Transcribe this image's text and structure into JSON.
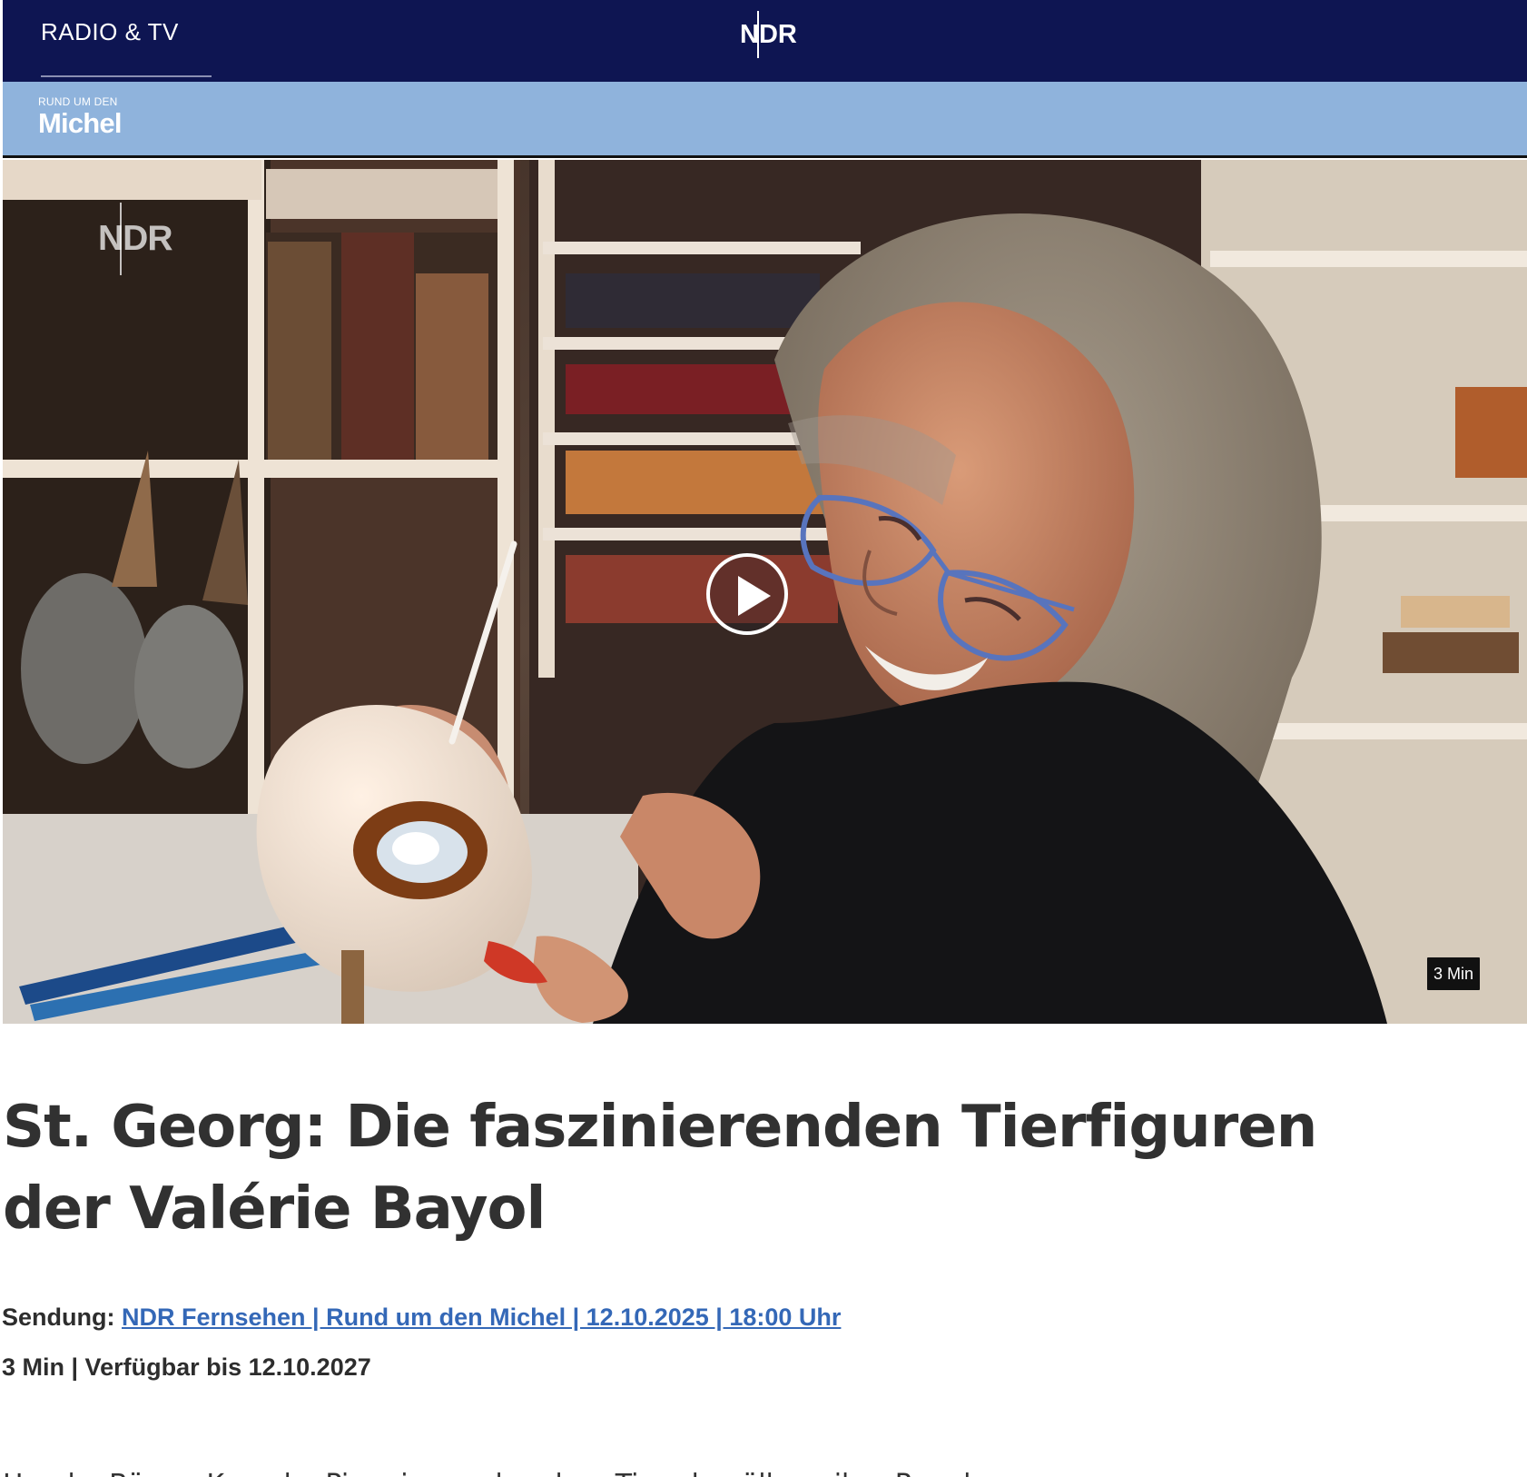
{
  "header": {
    "section_label": "RADIO & TV",
    "logo_text": "NDR"
  },
  "show": {
    "logo_small": "RUND UM DEN",
    "logo_big": "Michel"
  },
  "video": {
    "watermark": "NDR",
    "duration_badge": "3 Min"
  },
  "article": {
    "title": "St. Georg: Die faszinierenden Tierfiguren der Valérie Bayol",
    "broadcast_label": "Sendung:",
    "broadcast_link": "NDR Fernsehen | Rund um den Michel | 12.10.2025 | 18:00 Uhr",
    "meta": "3 Min | Verfügbar bis 12.10.2027",
    "teaser": "Hunde, Bären, Kamele, Pinguine und andere Tiere bevölkern ihre Regale."
  },
  "colors": {
    "top_bar": "#0e1552",
    "show_bar": "#8fb3dc",
    "link": "#3468b7",
    "text": "#313131"
  },
  "icons": {
    "play": "play-icon",
    "logo": "ndr-logo"
  }
}
